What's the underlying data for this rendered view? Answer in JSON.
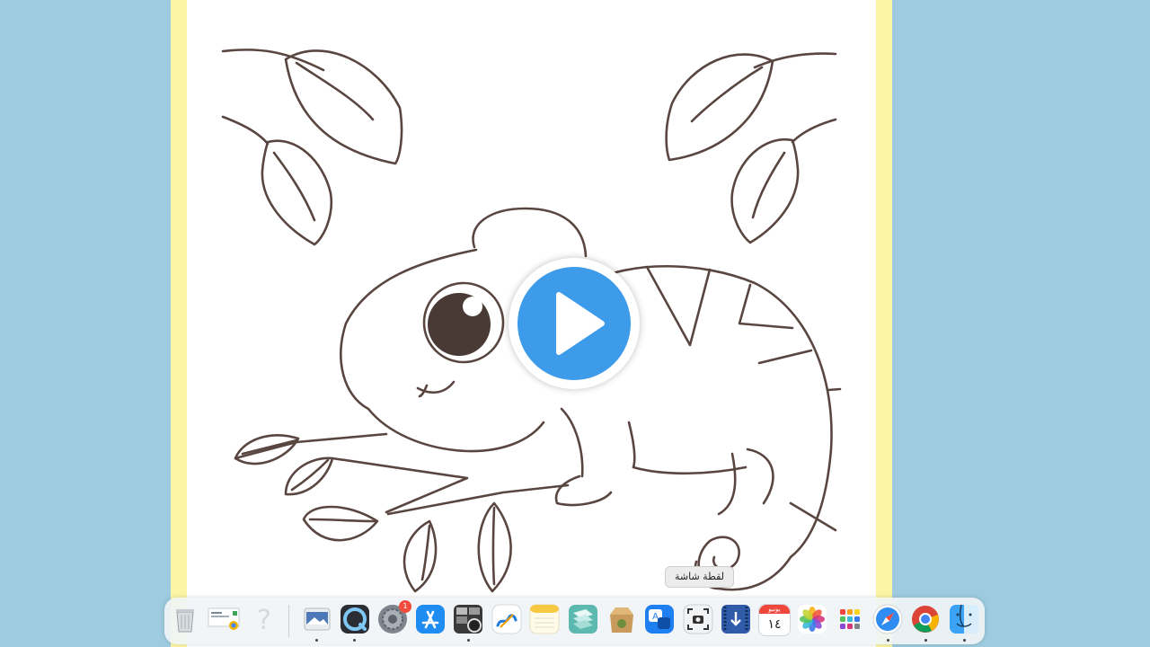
{
  "video": {
    "play_label": "Play video"
  },
  "tooltip": {
    "text": "لقطة شاشة"
  },
  "dock": {
    "items": [
      {
        "name": "trash",
        "label": "Trash"
      },
      {
        "name": "recent-window",
        "label": "Window"
      },
      {
        "name": "help",
        "label": "Help"
      },
      {
        "name": "preview",
        "label": "Preview"
      },
      {
        "name": "quicktime",
        "label": "QuickTime Player"
      },
      {
        "name": "system-settings",
        "label": "System Settings",
        "badge": "1"
      },
      {
        "name": "app-store",
        "label": "App Store"
      },
      {
        "name": "photo-booth",
        "label": "Photo Booth"
      },
      {
        "name": "freeform",
        "label": "Freeform"
      },
      {
        "name": "notes",
        "label": "Notes"
      },
      {
        "name": "files",
        "label": "Files"
      },
      {
        "name": "archive-utility",
        "label": "Archive Utility"
      },
      {
        "name": "translate",
        "label": "Translate"
      },
      {
        "name": "screenshot",
        "label": "Screenshot"
      },
      {
        "name": "downloader",
        "label": "Downloader"
      },
      {
        "name": "calendar",
        "label": "Calendar",
        "month": "يونيو",
        "day": "١٤"
      },
      {
        "name": "photos",
        "label": "Photos"
      },
      {
        "name": "launchpad",
        "label": "Launchpad"
      },
      {
        "name": "safari",
        "label": "Safari"
      },
      {
        "name": "chrome",
        "label": "Google Chrome"
      },
      {
        "name": "finder",
        "label": "Finder"
      }
    ]
  },
  "colors": {
    "background": "#9ecbdf",
    "frame_yellow": "#fbf5a6",
    "play_blue": "#3d9be9",
    "line_brown": "#5a4640"
  }
}
